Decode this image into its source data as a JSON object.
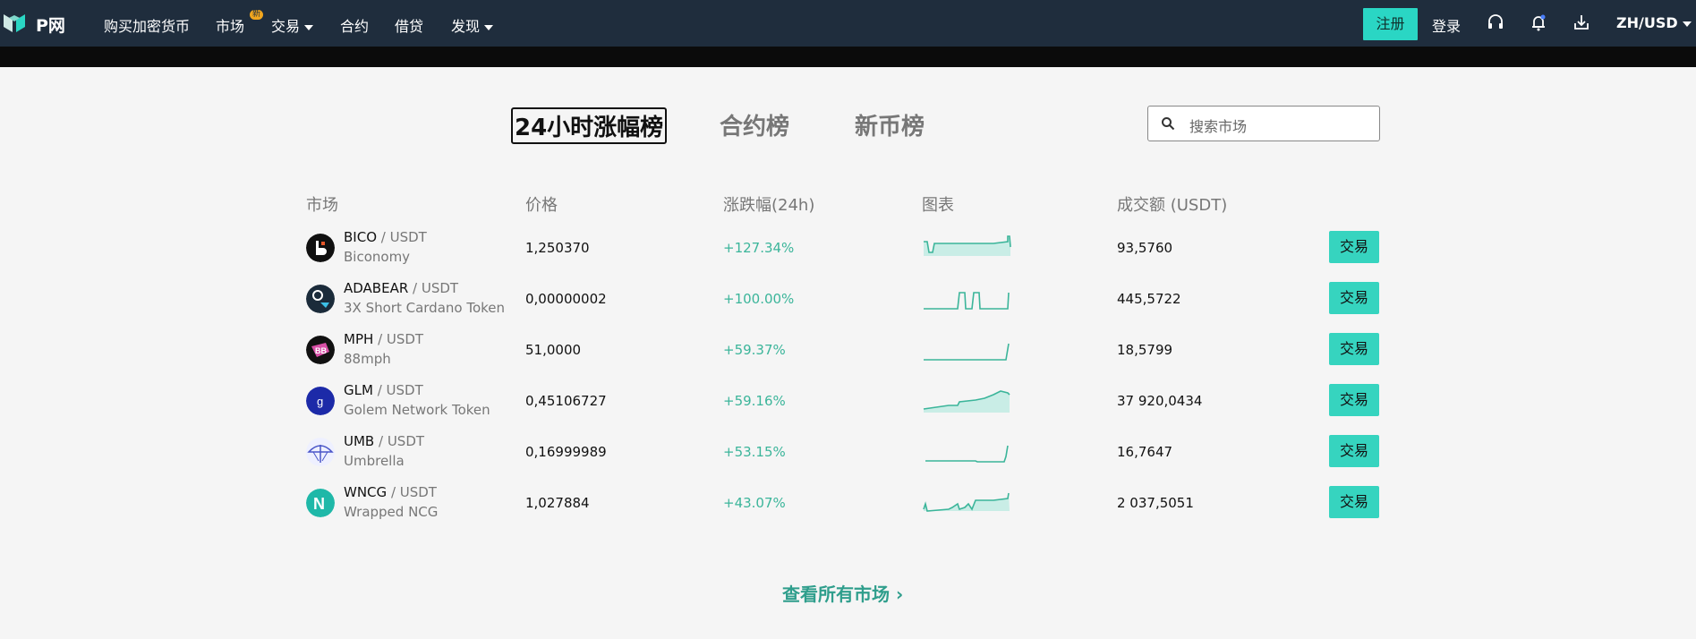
{
  "nav": {
    "brand": "P网",
    "buy_crypto": "购买加密货币",
    "market": "市场",
    "market_badge": "新",
    "trade": "交易",
    "contracts": "合约",
    "lending": "借贷",
    "discover": "发现",
    "signup": "注册",
    "login": "登录",
    "language": "ZH/USD",
    "icons": [
      "headset-icon",
      "bell-icon",
      "download-icon"
    ]
  },
  "tabs": [
    {
      "label": "24小时涨幅榜",
      "active": true
    },
    {
      "label": "合约榜",
      "active": false
    },
    {
      "label": "新币榜",
      "active": false
    }
  ],
  "search": {
    "placeholder": "搜索市场"
  },
  "table": {
    "headers": [
      "市场",
      "价格",
      "涨跌幅(24h)",
      "图表",
      "成交额 (USDT)"
    ],
    "rows": [
      {
        "symbol": "BICO",
        "quote": "/ USDT",
        "name": "Biconomy",
        "price": "1,250370",
        "change": "+127.34%",
        "volume": "93,5760",
        "action": "交易"
      },
      {
        "symbol": "ADABEAR",
        "quote": "/ USDT",
        "name": "3X Short Cardano Token",
        "price": "0,00000002",
        "change": "+100.00%",
        "volume": "445,5722",
        "action": "交易"
      },
      {
        "symbol": "MPH",
        "quote": "/ USDT",
        "name": "88mph",
        "price": "51,0000",
        "change": "+59.37%",
        "volume": "18,5799",
        "action": "交易"
      },
      {
        "symbol": "GLM",
        "quote": "/ USDT",
        "name": "Golem Network Token",
        "price": "0,45106727",
        "change": "+59.16%",
        "volume": "37 920,0434",
        "action": "交易"
      },
      {
        "symbol": "UMB",
        "quote": "/ USDT",
        "name": "Umbrella",
        "price": "0,16999989",
        "change": "+53.15%",
        "volume": "16,7647",
        "action": "交易"
      },
      {
        "symbol": "WNCG",
        "quote": "/ USDT",
        "name": "Wrapped NCG",
        "price": "1,027884",
        "change": "+43.07%",
        "volume": "2 037,5051",
        "action": "交易"
      }
    ]
  },
  "view_all": "查看所有市场 ›",
  "colors": {
    "nav_bg": "#1f2d3d",
    "accent": "#36d4bf",
    "positive": "#3bb59a"
  }
}
